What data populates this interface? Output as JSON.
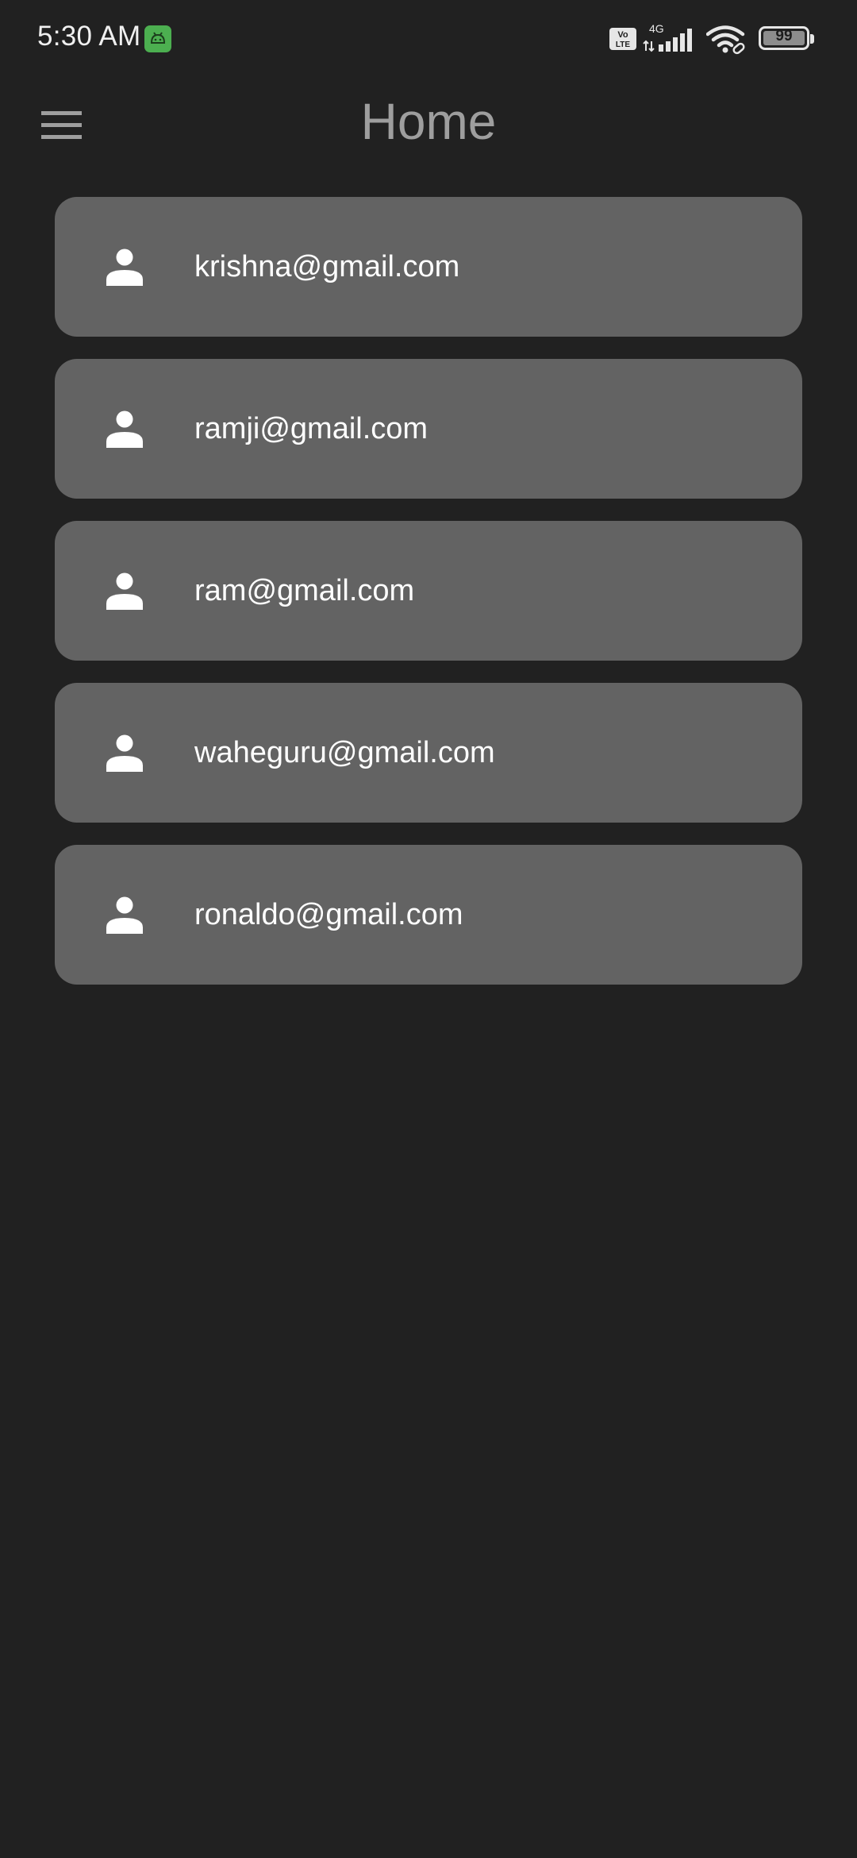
{
  "status_bar": {
    "time": "5:30 AM",
    "notification_icon": "android-app-icon",
    "network_label": "4G",
    "volte_label": "Vo LTE",
    "signal_icon": "signal-icon",
    "wifi_icon": "wifi-icon",
    "battery_level": "99"
  },
  "app_bar": {
    "menu_icon": "menu-icon",
    "title": "Home"
  },
  "users": [
    {
      "email": "krishna@gmail.com",
      "icon": "person-icon"
    },
    {
      "email": "ramji@gmail.com",
      "icon": "person-icon"
    },
    {
      "email": "ram@gmail.com",
      "icon": "person-icon"
    },
    {
      "email": "waheguru@gmail.com",
      "icon": "person-icon"
    },
    {
      "email": "ronaldo@gmail.com",
      "icon": "person-icon"
    }
  ],
  "colors": {
    "background": "#212121",
    "card": "#636363",
    "title": "#9e9e9e",
    "text": "#ffffff",
    "accent": "#4caf50"
  }
}
